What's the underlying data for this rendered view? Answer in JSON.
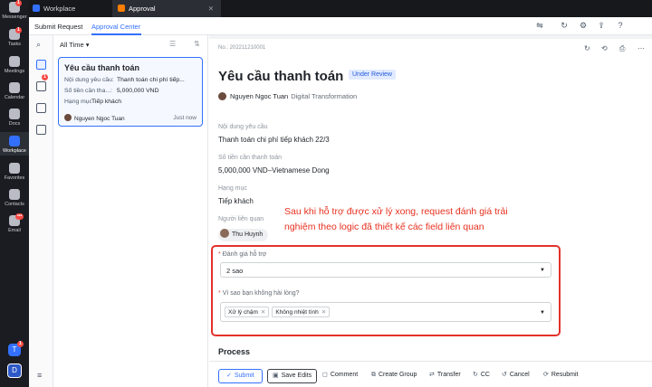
{
  "rail": {
    "items": [
      {
        "label": "Messenger",
        "badge": "1"
      },
      {
        "label": "Tasks",
        "badge": "1"
      },
      {
        "label": "Meetings",
        "badge": ""
      },
      {
        "label": "Calendar",
        "badge": ""
      },
      {
        "label": "Docs",
        "badge": ""
      },
      {
        "label": "Workplace",
        "badge": ""
      },
      {
        "label": "Favorites",
        "badge": ""
      },
      {
        "label": "Contacts",
        "badge": ""
      },
      {
        "label": "Email",
        "badge": "•••"
      }
    ],
    "user_initial": "T",
    "user_badge": "1",
    "org_initial": "D"
  },
  "tabs": [
    {
      "label": "Workplace",
      "icon": "workplace-icon",
      "color": "#3370ff"
    },
    {
      "label": "Approval",
      "icon": "approval-icon",
      "color": "#ff7d00",
      "close": "✕"
    }
  ],
  "subnav": {
    "submit": "Submit Request",
    "approval_center": "Approval Center"
  },
  "list": {
    "filter": "All Time ▾",
    "card": {
      "title": "Yêu cầu thanh toán",
      "rows": [
        {
          "k": "Nội dung yêu cầu:",
          "v": "Thanh toán chi phí tiếp..."
        },
        {
          "k": "Số tiền cần tha...:",
          "v": "5,000,000 VND"
        },
        {
          "k": "Hạng mục:",
          "v": "Tiếp khách"
        }
      ],
      "submitter": "Nguyen Ngoc Tuan",
      "time": "Just now"
    },
    "side_badge": "1"
  },
  "detail": {
    "no": "No.: 202211210001",
    "title": "Yêu cầu thanh toán",
    "status": "Under Review",
    "submitter": "Nguyen Ngoc Tuan",
    "department": "Digital Transformation",
    "fields": [
      {
        "label": "Nội dung yêu cầu",
        "value": "Thanh toán chi phí tiếp khách 22/3"
      },
      {
        "label": "Số tiền cần thanh toán",
        "value": "5,000,000 VND–Vietnamese Dong"
      },
      {
        "label": "Hạng mục",
        "value": "Tiếp khách"
      }
    ],
    "related_label": "Người liên quan",
    "related_person": "Thu Huynh",
    "annotation": "Sau khi hỗ trợ được xử lý xong, request đánh giá trải nghiệm theo logic đã thiết kế các field liên quan",
    "rating_label": "Đánh giá hỗ trợ",
    "rating_value": "2 sao",
    "reason_label": "Vì sao bạn không hài lòng?",
    "reason_tags": [
      "Xử lý chậm",
      "Không nhiệt tình"
    ],
    "process": "Process",
    "actions": {
      "submit": "Submit",
      "save": "Save Edits",
      "comment": "Comment",
      "group": "Create Group",
      "transfer": "Transfer",
      "cc": "CC",
      "cancel": "Cancel",
      "resubmit": "Resubmit"
    }
  },
  "colors": {
    "accent": "#3370ff",
    "alert": "#e3322b"
  }
}
